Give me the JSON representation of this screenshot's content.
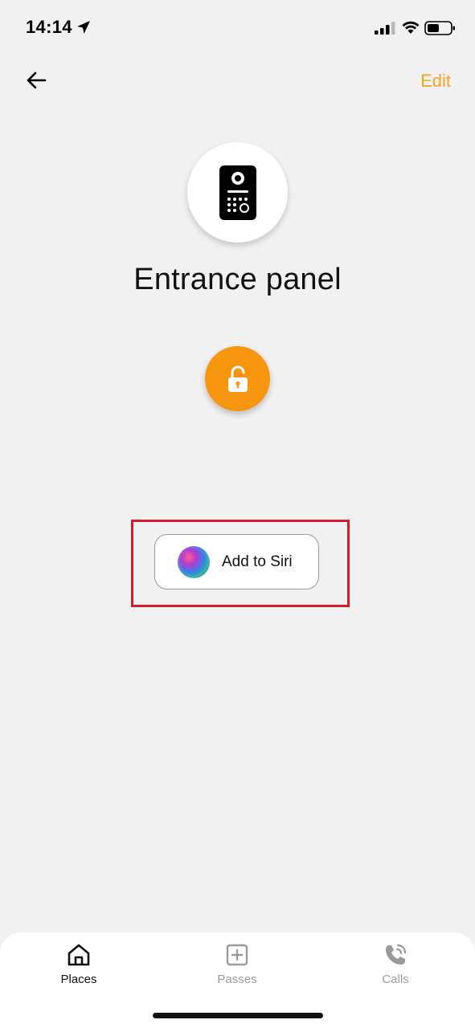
{
  "status_bar": {
    "time": "14:14",
    "icons": [
      "location-arrow-icon",
      "cellular-signal-icon",
      "wifi-icon",
      "battery-icon"
    ]
  },
  "nav": {
    "back_icon": "arrow-left-icon",
    "edit_label": "Edit"
  },
  "device": {
    "icon": "intercom-panel-icon",
    "title": "Entrance panel"
  },
  "unlock": {
    "icon": "unlocked-padlock-icon"
  },
  "siri": {
    "label": "Add to Siri",
    "icon": "siri-orb-icon"
  },
  "tabs": [
    {
      "label": "Places",
      "icon": "home-icon",
      "active": true
    },
    {
      "label": "Passes",
      "icon": "add-square-icon",
      "active": false
    },
    {
      "label": "Calls",
      "icon": "phone-icon",
      "active": false
    }
  ],
  "colors": {
    "accent": "#f7960e",
    "edit_text": "#f6a41c",
    "highlight": "#d41f2a",
    "background": "#f1f1f1",
    "inactive_tab": "#9a9a9a"
  }
}
